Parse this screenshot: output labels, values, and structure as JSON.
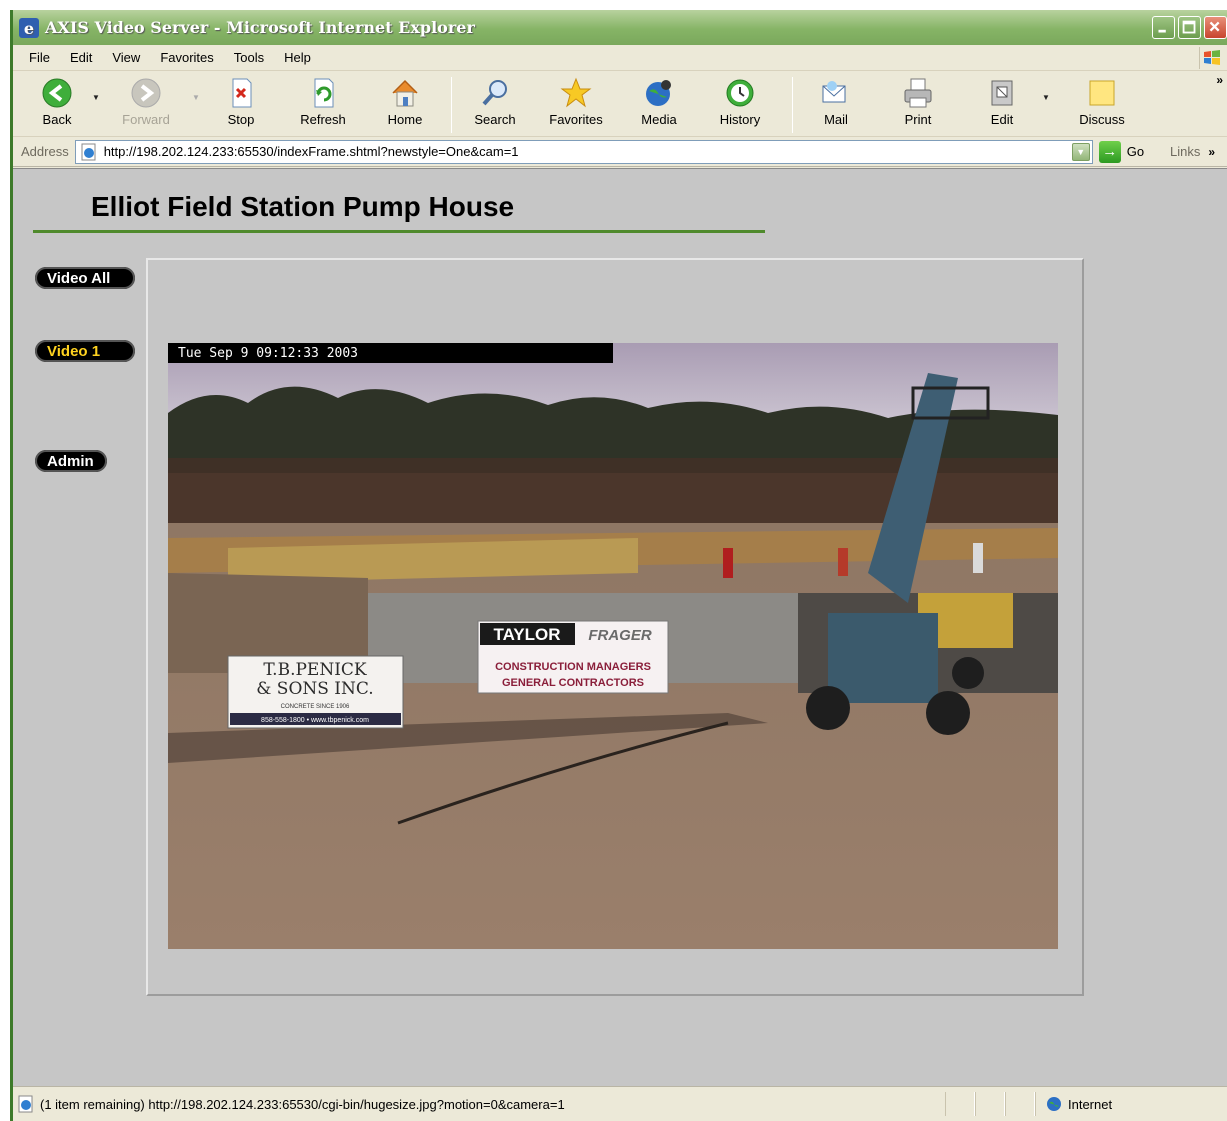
{
  "window": {
    "title": "AXIS Video Server - Microsoft Internet Explorer"
  },
  "menu": {
    "items": [
      "File",
      "Edit",
      "View",
      "Favorites",
      "Tools",
      "Help"
    ]
  },
  "toolbar": {
    "back": "Back",
    "forward": "Forward",
    "stop": "Stop",
    "refresh": "Refresh",
    "home": "Home",
    "search": "Search",
    "favorites": "Favorites",
    "media": "Media",
    "history": "History",
    "mail": "Mail",
    "print": "Print",
    "edit": "Edit",
    "discuss": "Discuss"
  },
  "address": {
    "label": "Address",
    "url": "http://198.202.124.233:65530/indexFrame.shtml?newstyle=One&cam=1",
    "go_label": "Go",
    "links_label": "Links"
  },
  "page": {
    "title": "Elliot Field Station Pump House",
    "nav": {
      "video_all": "Video All",
      "video_1": "Video 1",
      "admin": "Admin"
    },
    "timestamp": "Tue Sep  9 09:12:33 2003",
    "signs": {
      "penick_line1": "T.B.PENICK",
      "penick_line2": "& SONS INC.",
      "penick_line3": "CONCRETE SINCE 1906",
      "penick_line4": "858-558-1800 • www.tbpenick.com",
      "taylor_a": "TAYLOR",
      "taylor_b": "FRAGER",
      "taylor_sub1": "CONSTRUCTION MANAGERS",
      "taylor_sub2": "GENERAL CONTRACTORS"
    }
  },
  "status": {
    "text": "(1 item remaining) http://198.202.124.233:65530/cgi-bin/hugesize.jpg?motion=0&camera=1",
    "zone": "Internet"
  },
  "colors": {
    "title_green": "#4f8a2c",
    "page_bg": "#c6c6c6",
    "active_nav": "#ffd320"
  }
}
